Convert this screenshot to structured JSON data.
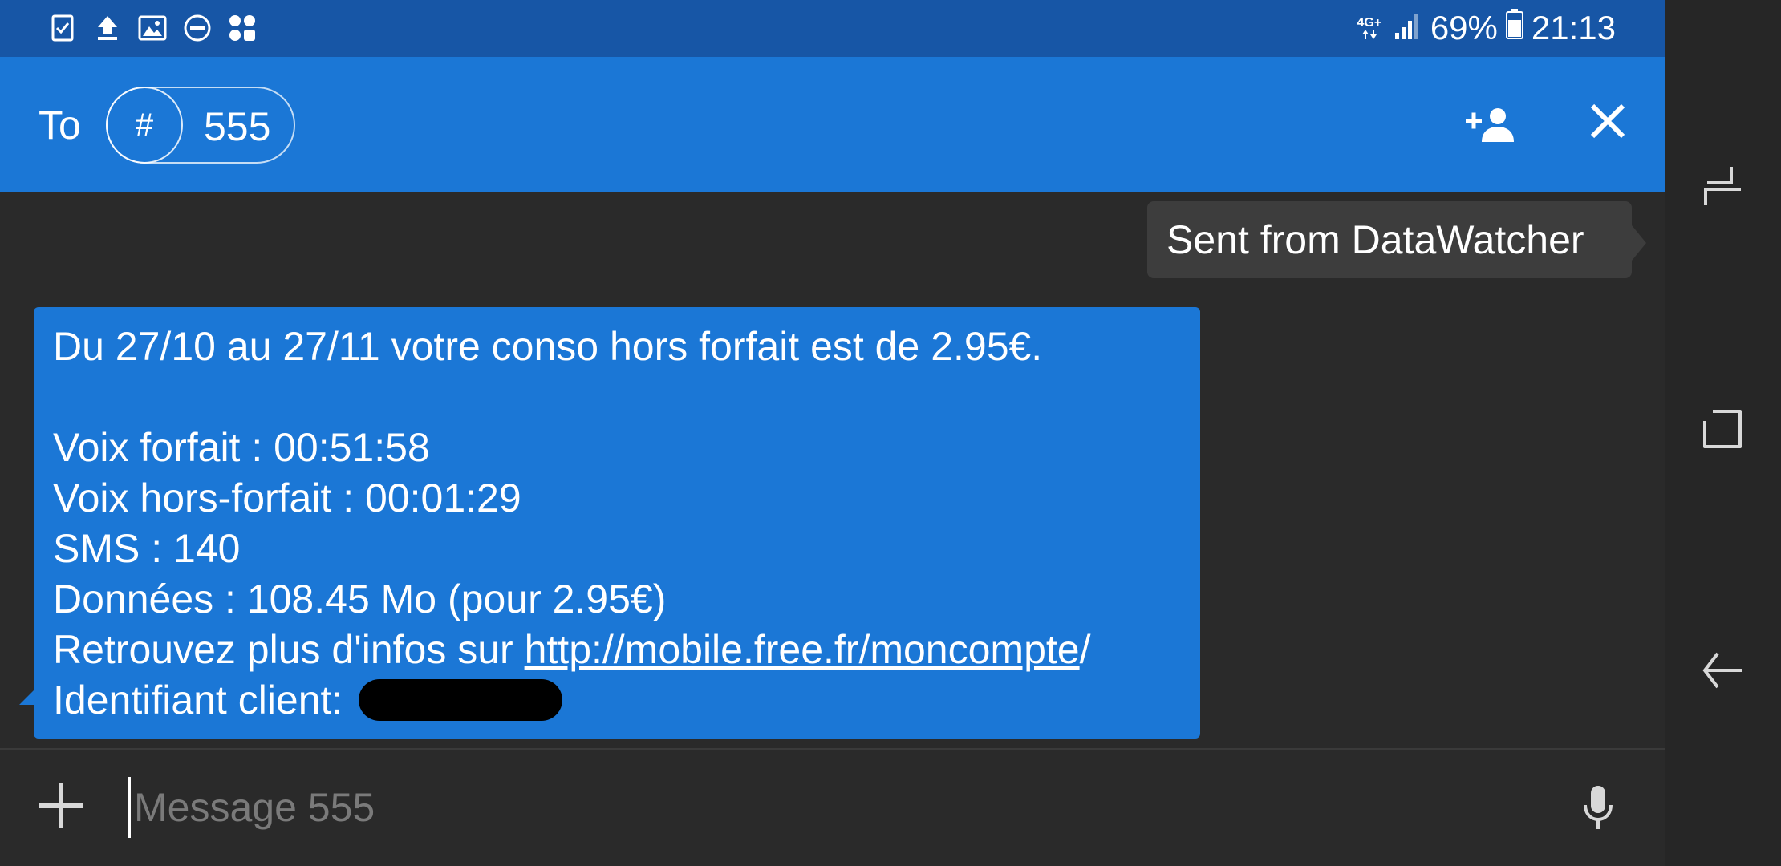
{
  "status_bar": {
    "left_icons": [
      "task-check-icon",
      "upload-icon",
      "image-icon",
      "do-not-disturb-icon",
      "app-shortcuts-icon"
    ],
    "network": "4G+",
    "battery_percent": "69%",
    "time": "21:13"
  },
  "header": {
    "to_label": "To",
    "recipient_type_symbol": "#",
    "recipient_number": "555",
    "add_contact_icon": "person-add-icon",
    "close_icon": "close-icon"
  },
  "tooltip": {
    "text": "Sent from DataWatcher"
  },
  "message": {
    "lines": [
      "Du 27/10 au 27/11 votre conso hors forfait est de 2.95€.",
      "",
      "Voix forfait : 00:51:58",
      "Voix hors-forfait : 00:01:29",
      "SMS : 140",
      "Données : 108.45 Mo (pour 2.95€)"
    ],
    "info_prefix": "Retrouvez plus d'infos sur ",
    "info_link": "http://mobile.free.fr/moncompte",
    "info_suffix": "/",
    "client_id_label": "Identifiant client: "
  },
  "composer": {
    "attach_icon": "plus-icon",
    "placeholder": "Message 555",
    "mic_icon": "microphone-icon"
  },
  "nav_bar": {
    "recent_icon": "recent-apps-icon",
    "home_icon": "home-icon",
    "back_icon": "back-icon"
  },
  "colors": {
    "status_bar": "#1756a6",
    "header": "#1b77d6",
    "bubble": "#1b77d6",
    "background": "#2a2a2a",
    "tooltip": "#3d3d3d"
  }
}
